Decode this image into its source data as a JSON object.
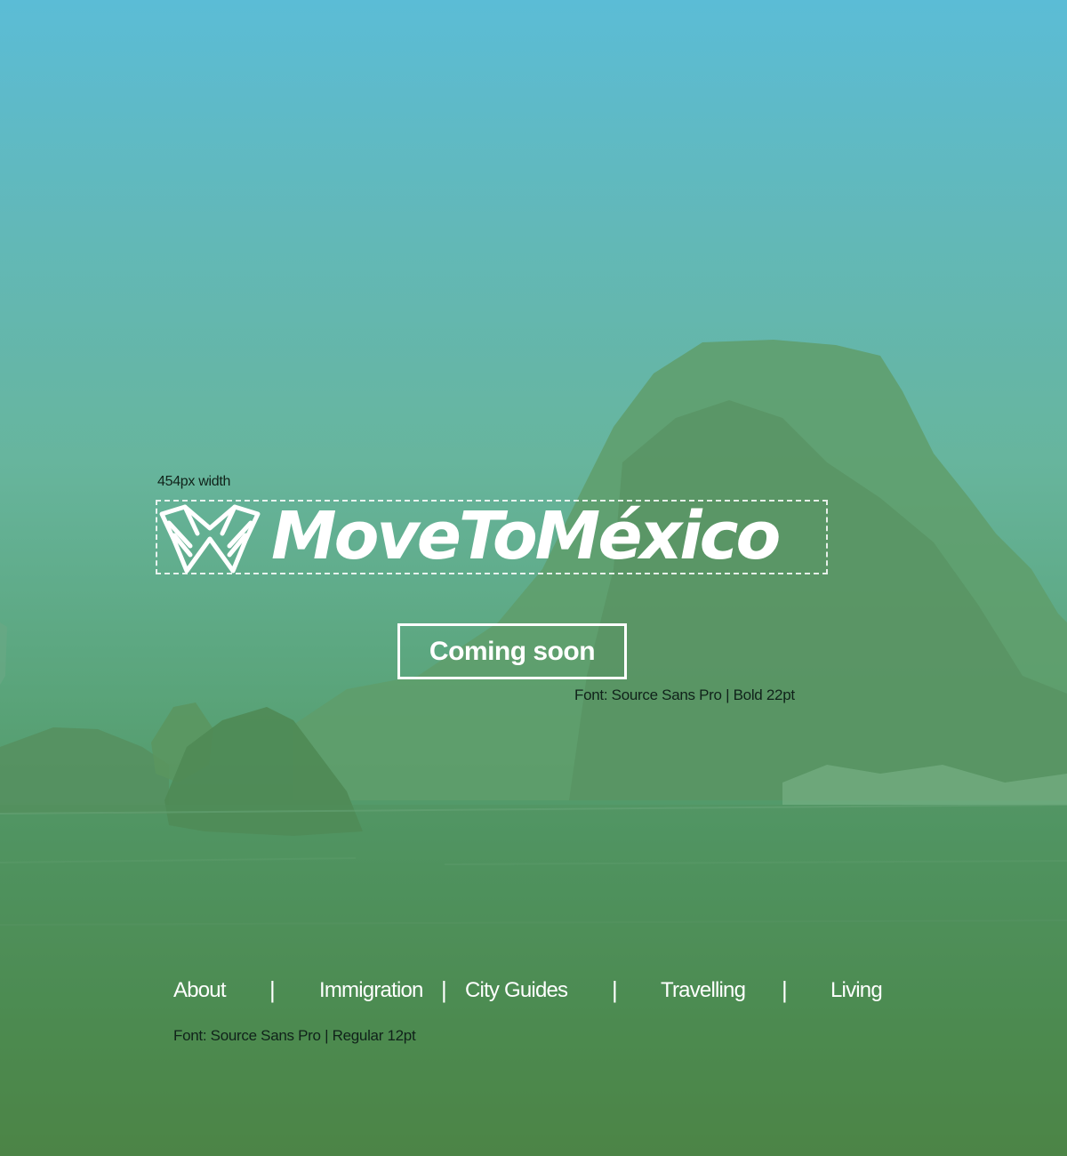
{
  "annotations": {
    "logo_width": "454px width",
    "cta_font": "Font: Source Sans Pro  |  Bold 22pt",
    "nav_font": "Font: Source Sans Pro  |  Regular 12pt"
  },
  "logo": {
    "wordmark": "MoveToMéxico",
    "icon": "winged-m-icon"
  },
  "cta": {
    "label": "Coming soon"
  },
  "nav": {
    "items": [
      {
        "label": "About"
      },
      {
        "label": "Immigration"
      },
      {
        "label": "City Guides"
      },
      {
        "label": "Travelling"
      },
      {
        "label": "Living"
      }
    ],
    "separator": "|"
  },
  "colors": {
    "sky_top": "#5bbcd6",
    "sea_bottom": "#4a7f3b",
    "rock": "#5e9a6a",
    "text": "#ffffff",
    "annotation": "#10221a"
  }
}
